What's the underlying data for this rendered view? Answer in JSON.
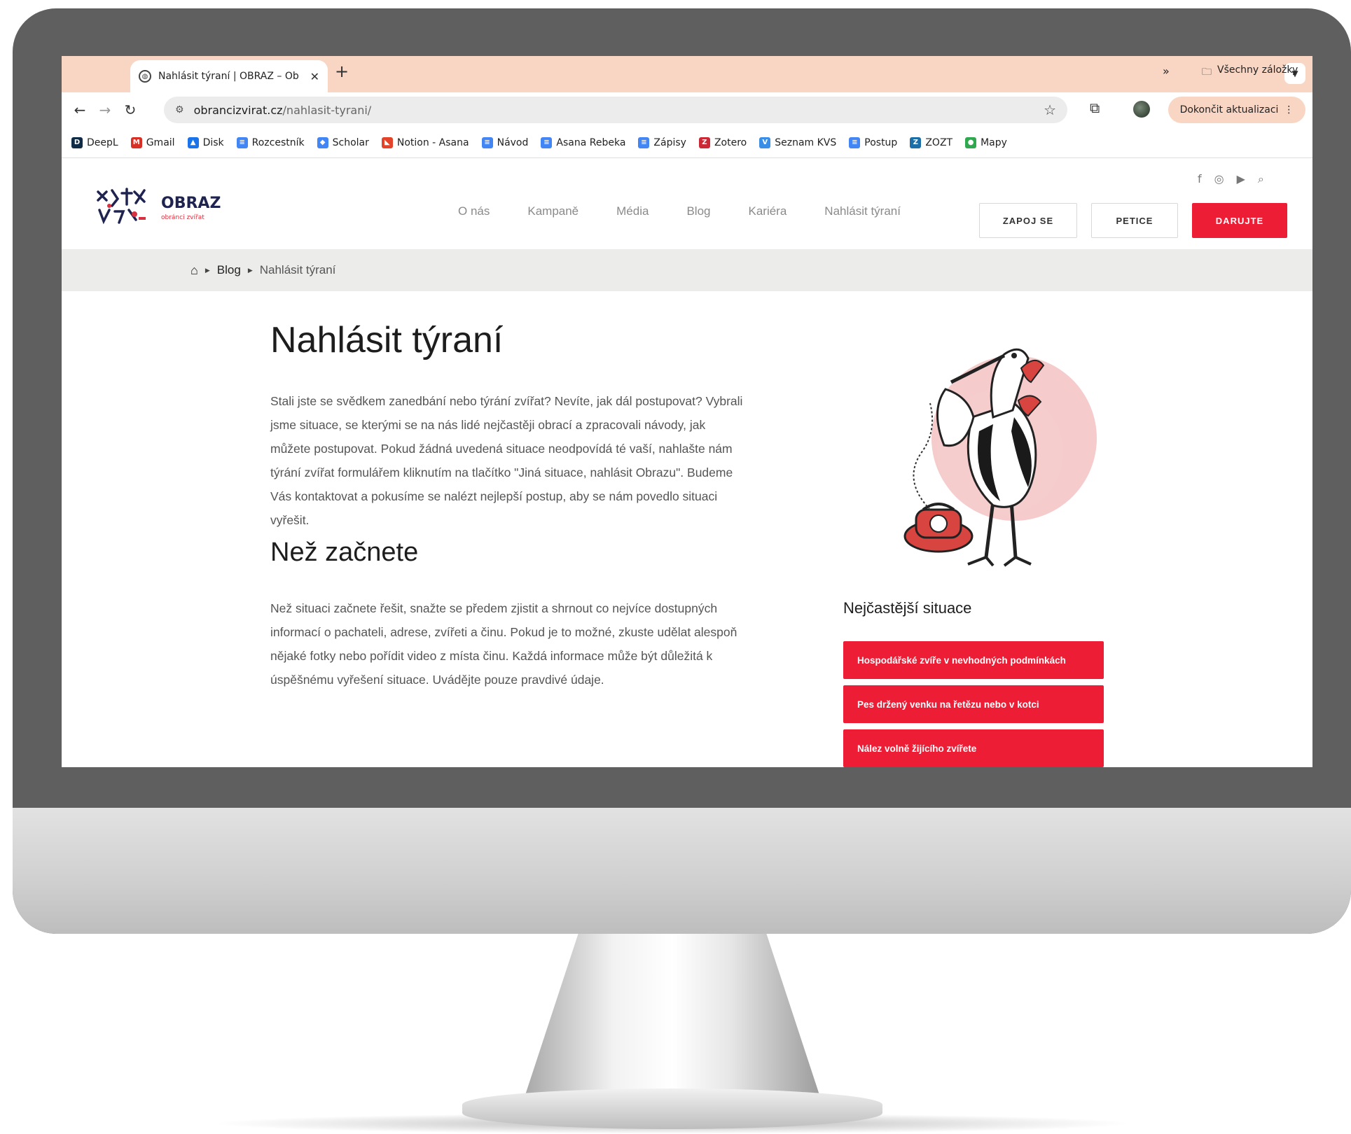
{
  "browser": {
    "tab": {
      "title": "Nahlásit týraní | OBRAZ – Ob"
    },
    "new_tab": "+",
    "url_domain": "obrancizvirat.cz",
    "url_path": "/nahlasit-tyrani/",
    "update_button": "Dokončit aktualizaci",
    "bookmarks": [
      {
        "label": "DeepL",
        "icon": "deepl-icon",
        "color": "#0f2b46"
      },
      {
        "label": "Gmail",
        "icon": "gmail-icon",
        "color": "#d93025"
      },
      {
        "label": "Disk",
        "icon": "drive-icon",
        "color": "#1a73e8"
      },
      {
        "label": "Rozcestník",
        "icon": "docs-icon",
        "color": "#4285f4"
      },
      {
        "label": "Scholar",
        "icon": "scholar-icon",
        "color": "#4285f4"
      },
      {
        "label": "Notion - Asana",
        "icon": "gitlab-icon",
        "color": "#e24329"
      },
      {
        "label": "Návod",
        "icon": "docs-icon",
        "color": "#4285f4"
      },
      {
        "label": "Asana Rebeka",
        "icon": "docs-icon",
        "color": "#4285f4"
      },
      {
        "label": "Zápisy",
        "icon": "docs-icon",
        "color": "#4285f4"
      },
      {
        "label": "Zotero",
        "icon": "zotero-icon",
        "color": "#cc2936"
      },
      {
        "label": "Seznam KVS",
        "icon": "v-icon",
        "color": "#3a8ee6"
      },
      {
        "label": "Postup",
        "icon": "docs-icon",
        "color": "#4285f4"
      },
      {
        "label": "ZOZT",
        "icon": "z-icon",
        "color": "#1b6ea8"
      },
      {
        "label": "Mapy",
        "icon": "mapy-icon",
        "color": "#2fa84f"
      }
    ],
    "bookmarks_more": "»",
    "all_bookmarks": "Všechny záložky"
  },
  "site": {
    "logo": {
      "name": "OBRAZ",
      "tagline": "obránci zvířat"
    },
    "nav": [
      "O nás",
      "Kampaně",
      "Média",
      "Blog",
      "Kariéra",
      "Nahlásit týraní"
    ],
    "buttons": {
      "join": "ZAPOJ SE",
      "petition": "PETICE",
      "donate": "DARUJTE"
    },
    "breadcrumb": {
      "blog": "Blog",
      "current": "Nahlásit týraní"
    }
  },
  "main": {
    "title": "Nahlásit týraní",
    "intro": "Stali jste se svědkem zanedbání nebo týrání zvířat? Nevíte, jak dál postupovat? Vybrali jsme situace, se kterými se na nás lidé nejčastěji obrací a zpracovali návody, jak můžete postupovat. Pokud žádná uvedená situace neodpovídá té vaší, nahlašte nám týrání zvířat formulářem kliknutím na tlačítko \"Jiná situace, nahlásit Obrazu\". Budeme Vás kontaktovat a pokusíme se nalézt nejlepší postup, aby se nám povedlo situaci vyřešit.",
    "before_title": "Než začnete",
    "before_text": "Než situaci začnete řešit, snažte se předem zjistit a shrnout co nejvíce dostupných informací o pachateli, adrese, zvířeti a činu. Pokud je to možné, zkuste udělat alespoň nějaké fotky nebo pořídit video z místa činu. Každá informace může být důležitá k úspěšnému vyřešení situace. Uvádějte pouze pravdivé údaje."
  },
  "sidebar": {
    "title": "Nejčastější situace",
    "situations": [
      "Hospodářské zvíře v nevhodných podmínkách",
      "Pes držený venku na řetězu nebo v kotci",
      "Nález volně žijícího zvířete"
    ]
  },
  "colors": {
    "accent": "#ee1d36",
    "tab_strip": "#f9d5c3",
    "logo_navy": "#1f2350"
  }
}
